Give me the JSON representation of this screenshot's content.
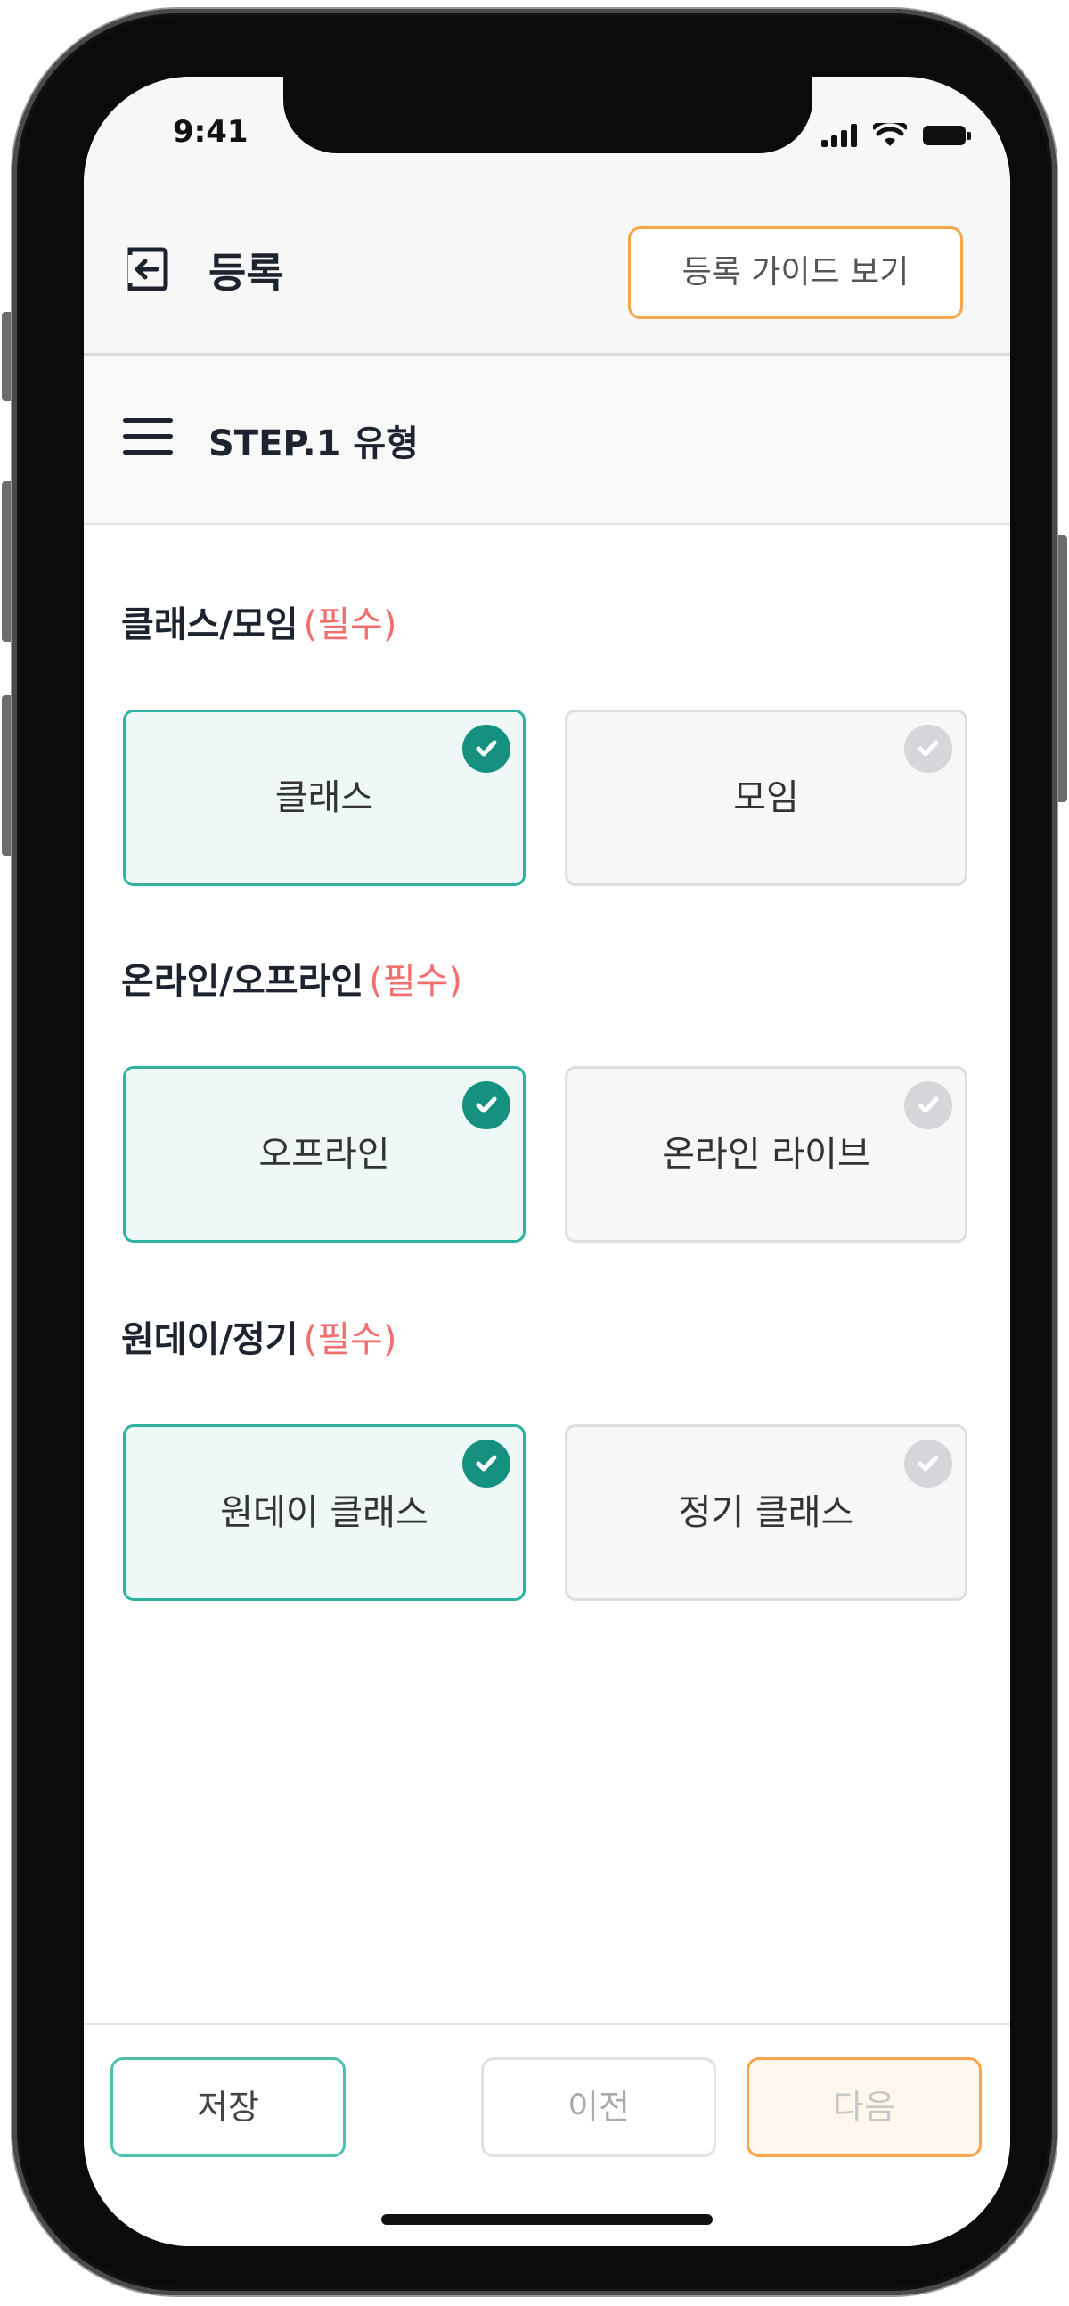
{
  "status_bar": {
    "time": "9:41"
  },
  "header": {
    "title": "등록",
    "guide_button": "등록 가이드 보기"
  },
  "step": {
    "title": "STEP.1 유형"
  },
  "sections": [
    {
      "label": "클래스/모임",
      "required": "(필수)",
      "options": [
        {
          "label": "클래스",
          "selected": true
        },
        {
          "label": "모임",
          "selected": false
        }
      ]
    },
    {
      "label": "온라인/오프라인",
      "required": "(필수)",
      "options": [
        {
          "label": "오프라인",
          "selected": true
        },
        {
          "label": "온라인 라이브",
          "selected": false
        }
      ]
    },
    {
      "label": "원데이/정기",
      "required": "(필수)",
      "options": [
        {
          "label": "원데이 클래스",
          "selected": true
        },
        {
          "label": "정기 클래스",
          "selected": false
        }
      ]
    }
  ],
  "footer": {
    "save": "저장",
    "prev": "이전",
    "next": "다음"
  },
  "colors": {
    "accent_teal": "#16917f",
    "accent_orange": "#f5a54a",
    "required_red": "#f36f6f"
  }
}
